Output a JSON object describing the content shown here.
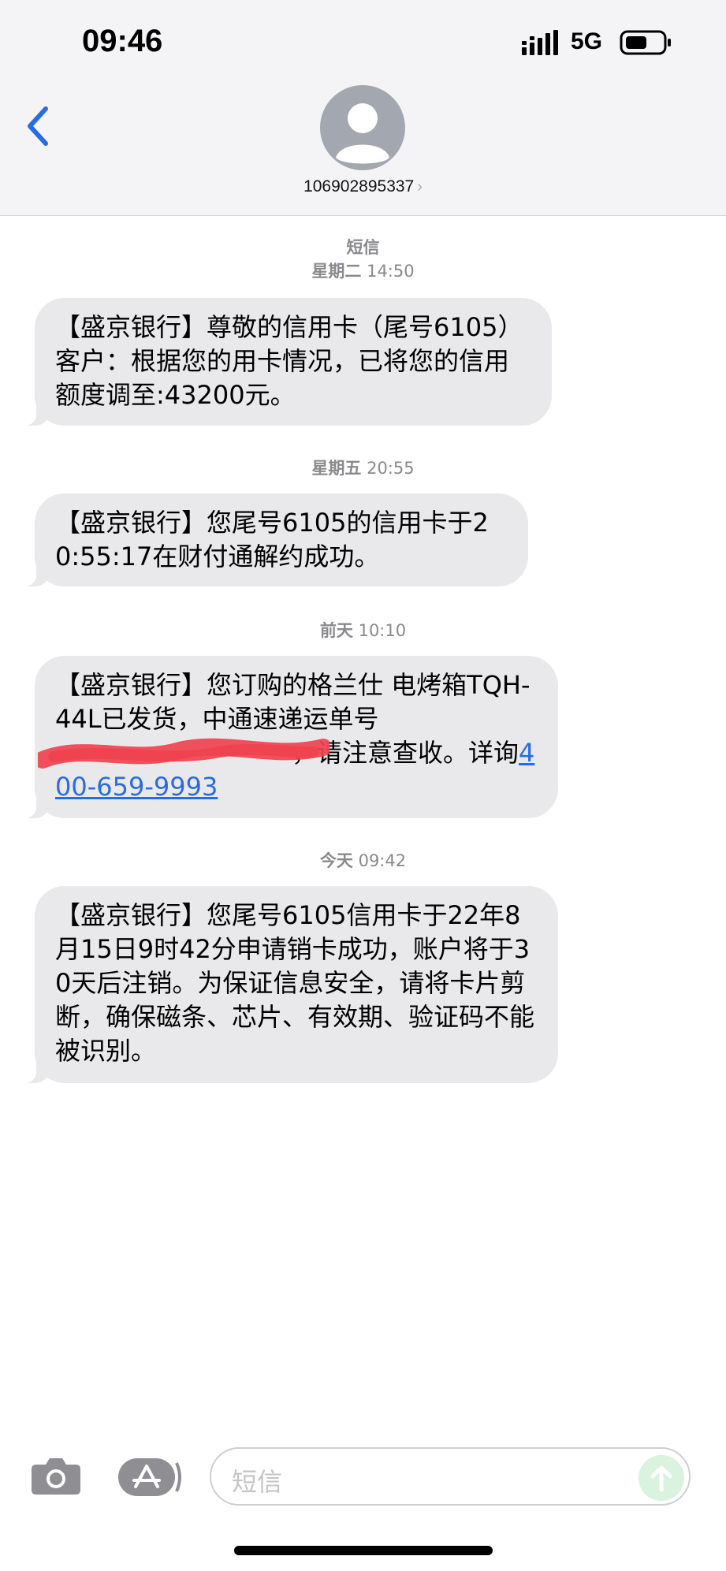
{
  "status_bar": {
    "time": "09:46",
    "network": "5G"
  },
  "header": {
    "contact": "106902895337",
    "back_icon": "chevron-left-icon",
    "avatar_icon": "person-icon"
  },
  "conversation": {
    "service_label": "短信",
    "stamps": [
      {
        "day": "星期二",
        "time": "14:50"
      },
      {
        "day": "星期五",
        "time": "20:55"
      },
      {
        "day": "前天",
        "time": "10:10"
      },
      {
        "day": "今天",
        "time": "09:42"
      }
    ],
    "messages": [
      {
        "text": "【盛京银行】尊敬的信用卡（尾号6105）客户：根据您的用卡情况，已将您的信用额度调至:43200元。"
      },
      {
        "text": "【盛京银行】您尾号6105的信用卡于20:55:17在财付通解约成功。"
      },
      {
        "text_before": "【盛京银行】您订购的格兰仕 电烤箱TQH-44L已发货，中通速递运单号",
        "text_after": "，请注意查收。详询",
        "link": "400-659-9993"
      },
      {
        "text": "【盛京银行】您尾号6105信用卡于22年8月15日9时42分申请销卡成功，账户将于30天后注销。为保证信息安全，请将卡片剪断，确保磁条、芯片、有效期、验证码不能被识别。"
      }
    ]
  },
  "composer": {
    "placeholder": "短信",
    "camera_icon": "camera-icon",
    "appstore_icon": "app-store-icon",
    "send_icon": "arrow-up-icon"
  },
  "colors": {
    "accent": "#2b6be0",
    "bubble": "#e9e9eb",
    "header_bg": "#f4f4f6",
    "redaction": "#f0424f"
  }
}
